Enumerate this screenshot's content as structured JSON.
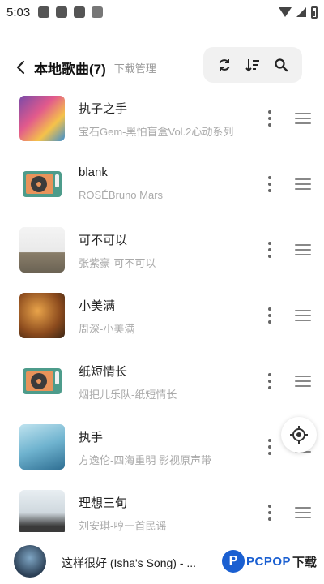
{
  "status_bar": {
    "time": "5:03"
  },
  "header": {
    "title": "本地歌曲(7)",
    "subtitle": "下载管理"
  },
  "songs": [
    {
      "title": "执子之手",
      "subtitle": "宝石Gem-黑怕盲盒Vol.2心动系列",
      "cover": "album-art-colorful"
    },
    {
      "title": "blank",
      "subtitle": "ROSÉBruno Mars",
      "cover": "record-player"
    },
    {
      "title": "可不可以",
      "subtitle": "张紫豪-可不可以",
      "cover": "album-art-landscape"
    },
    {
      "title": "小美满",
      "subtitle": "周深-小美满",
      "cover": "album-art-warm"
    },
    {
      "title": "纸短情长",
      "subtitle": "烟把儿乐队-纸短情长",
      "cover": "record-player"
    },
    {
      "title": "执手",
      "subtitle": "方逸伦-四海重明 影视原声带",
      "cover": "album-art-blue"
    },
    {
      "title": "理想三旬",
      "subtitle": "刘安琪-哼一首民谣",
      "cover": "album-art-portrait"
    }
  ],
  "player": {
    "title": "这样很好 (Isha's Song) - ..."
  },
  "watermark": {
    "letter": "P",
    "brand": "PCPOP",
    "suffix": "下载"
  },
  "colors": {
    "accent": "#1a5fd1",
    "record_teal": "#4d9c8b",
    "record_orange": "#e8935a"
  }
}
